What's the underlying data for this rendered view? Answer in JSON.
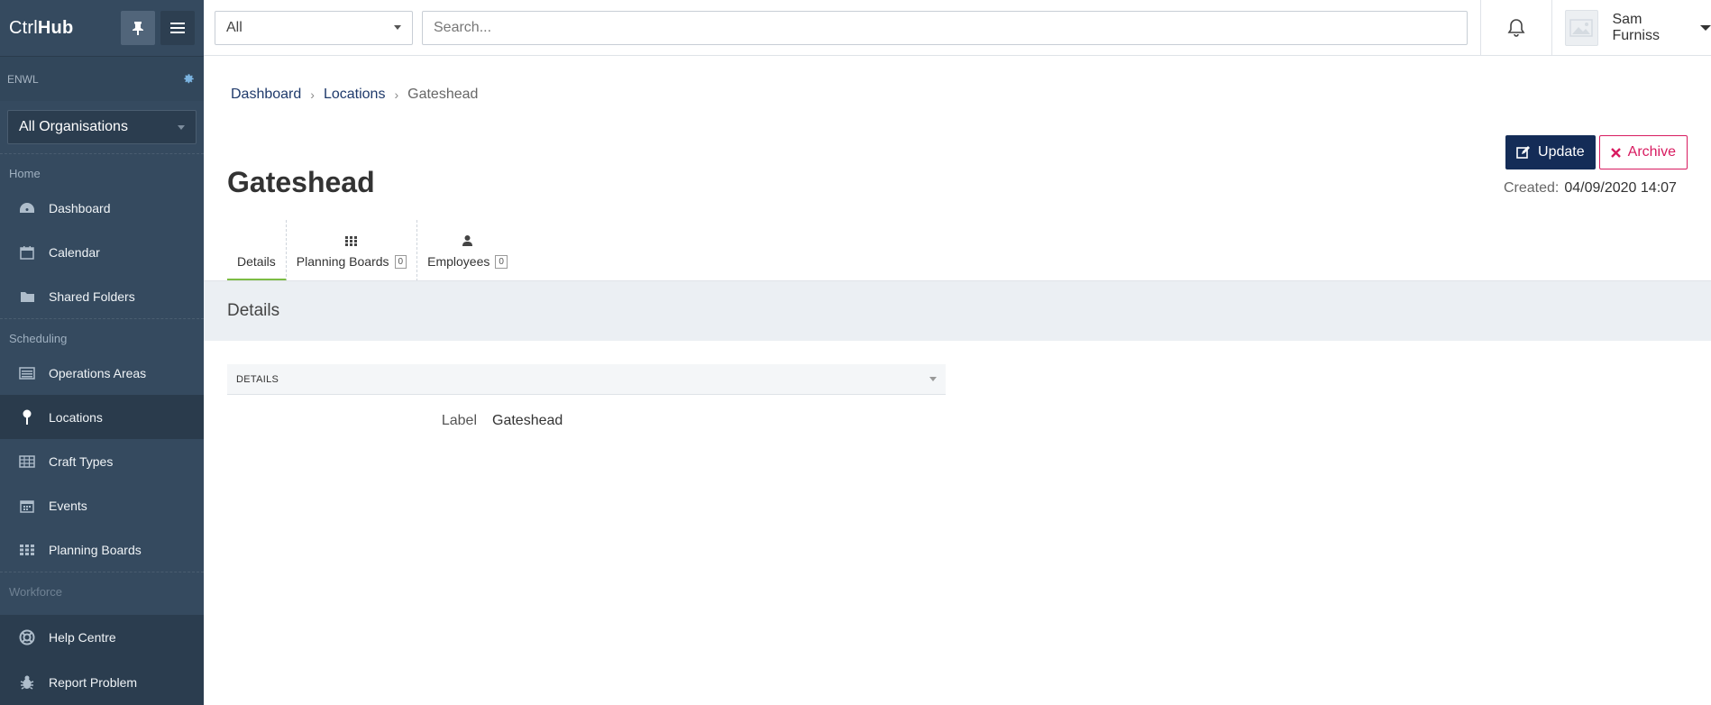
{
  "app": {
    "logo_light": "Ctrl",
    "logo_bold": "Hub"
  },
  "sidebar": {
    "org_code": "ENWL",
    "org_selected": "All Organisations",
    "sections": [
      {
        "title": "Home",
        "items": [
          {
            "label": "Dashboard",
            "icon": "dashboard-icon"
          },
          {
            "label": "Calendar",
            "icon": "calendar-icon"
          },
          {
            "label": "Shared Folders",
            "icon": "folder-icon"
          }
        ]
      },
      {
        "title": "Scheduling",
        "items": [
          {
            "label": "Operations Areas",
            "icon": "list-icon"
          },
          {
            "label": "Locations",
            "icon": "location-pin-icon",
            "active": true
          },
          {
            "label": "Craft Types",
            "icon": "table-icon"
          },
          {
            "label": "Events",
            "icon": "calendar-grid-icon"
          },
          {
            "label": "Planning Boards",
            "icon": "grid-icon"
          }
        ]
      },
      {
        "title": "Workforce",
        "items": []
      }
    ],
    "bottom": [
      {
        "label": "Help Centre",
        "icon": "lifebuoy-icon"
      },
      {
        "label": "Report Problem",
        "icon": "bug-icon"
      }
    ]
  },
  "topbar": {
    "scope_selected": "All",
    "search_placeholder": "Search...",
    "user_name": "Sam Furniss"
  },
  "breadcrumb": {
    "items": [
      "Dashboard",
      "Locations"
    ],
    "current": "Gateshead"
  },
  "page": {
    "title": "Gateshead",
    "update_label": "Update",
    "archive_label": "Archive",
    "created_label": "Created:",
    "created_value": "04/09/2020 14:07"
  },
  "tabs": [
    {
      "label": "Details",
      "active": true
    },
    {
      "label": "Planning Boards",
      "count": "0",
      "icon": "grid-icon"
    },
    {
      "label": "Employees",
      "count": "0",
      "icon": "user-icon"
    }
  ],
  "section": {
    "title": "Details",
    "panel_title": "DETAILS",
    "fields": [
      {
        "label": "Label",
        "value": "Gateshead"
      }
    ]
  },
  "colors": {
    "sidebar_bg": "#354a5f",
    "primary": "#142c57",
    "danger": "#d81b60",
    "tab_active": "#7cbc44"
  }
}
